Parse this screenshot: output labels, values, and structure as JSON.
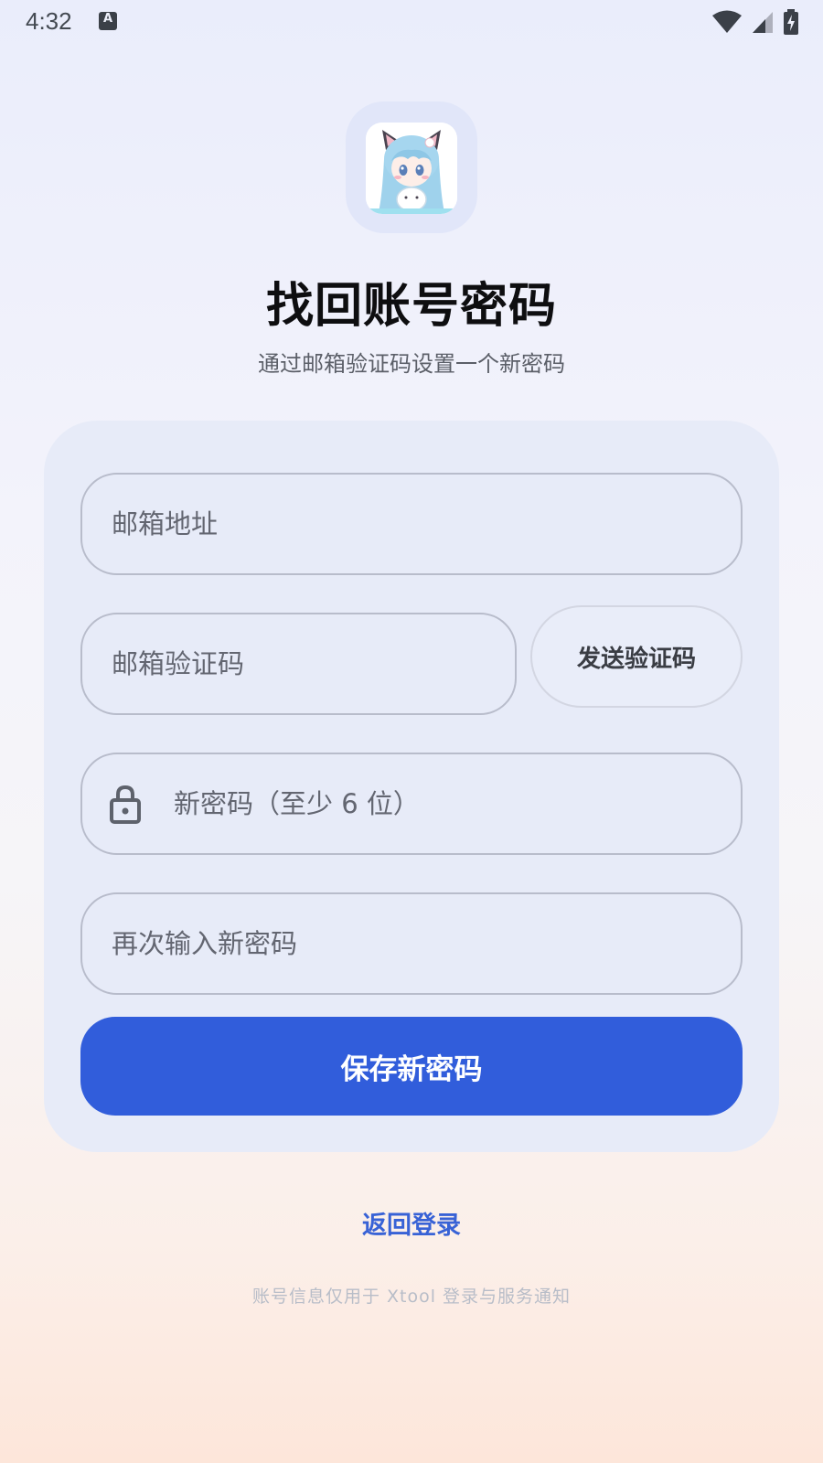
{
  "status_bar": {
    "time": "4:32",
    "notification_icon_glyph": "A",
    "icons": [
      "wifi-icon",
      "signal-icon",
      "battery-charging-icon"
    ]
  },
  "logo": {
    "icon": "app-logo-anime-character"
  },
  "header": {
    "title": "找回账号密码",
    "subtitle": "通过邮箱验证码设置一个新密码"
  },
  "form": {
    "email_placeholder": "邮箱地址",
    "email_value": "",
    "code_placeholder": "邮箱验证码",
    "code_value": "",
    "send_code_label": "发送验证码",
    "new_password_placeholder": "新密码（至少 6 位）",
    "new_password_value": "",
    "confirm_password_placeholder": "再次输入新密码",
    "confirm_password_value": "",
    "save_label": "保存新密码"
  },
  "back_link": "返回登录",
  "footer_note": "账号信息仅用于 Xtool 登录与服务通知",
  "colors": {
    "accent": "#315ddb",
    "link": "#3862d6",
    "card_bg": "#e7ebf8",
    "title": "#0e0e10"
  }
}
